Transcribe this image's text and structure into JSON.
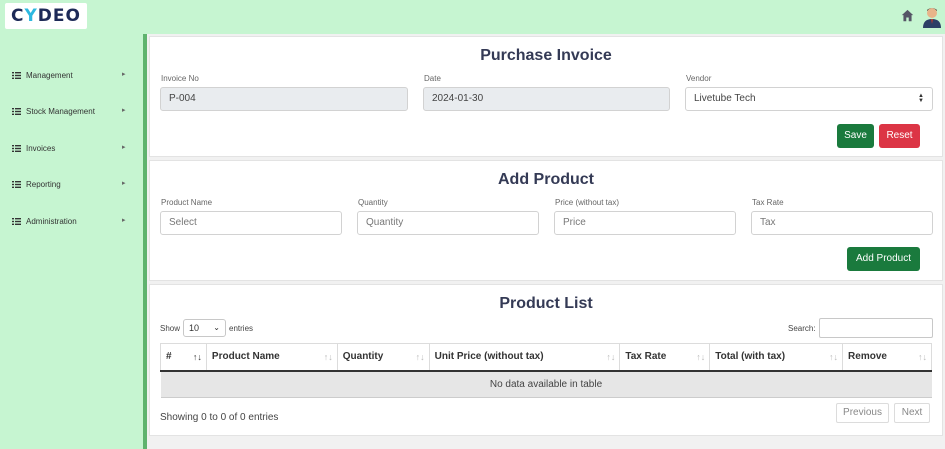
{
  "brand": {
    "logo_pre": "C",
    "logo_accent": "Y",
    "logo_post": "DEO"
  },
  "sidebar": {
    "items": [
      {
        "label": "Management"
      },
      {
        "label": "Stock Management"
      },
      {
        "label": "Invoices"
      },
      {
        "label": "Reporting"
      },
      {
        "label": "Administration"
      }
    ]
  },
  "invoice": {
    "title": "Purchase Invoice",
    "invoice_no_label": "Invoice No",
    "invoice_no_value": "P-004",
    "date_label": "Date",
    "date_value": "2024-01-30",
    "vendor_label": "Vendor",
    "vendor_value": "Livetube Tech",
    "save_label": "Save",
    "reset_label": "Reset"
  },
  "add_product": {
    "title": "Add Product",
    "name_label": "Product Name",
    "name_placeholder": "Select",
    "qty_label": "Quantity",
    "qty_placeholder": "Quantity",
    "price_label": "Price (without tax)",
    "price_placeholder": "Price",
    "tax_label": "Tax Rate",
    "tax_placeholder": "Tax",
    "button_label": "Add Product"
  },
  "product_list": {
    "title": "Product List",
    "show_label": "Show",
    "entries_value": "10",
    "entries_label": "entries",
    "search_label": "Search:",
    "columns": [
      "#",
      "Product Name",
      "Quantity",
      "Unit Price (without tax)",
      "Tax Rate",
      "Total (with tax)",
      "Remove"
    ],
    "empty_text": "No data available in table",
    "info_text": "Showing 0 to 0 of 0 entries",
    "previous_label": "Previous",
    "next_label": "Next"
  },
  "colors": {
    "topbar": "#c6f5d1",
    "sidebar_border": "#5fb36e",
    "primary_green": "#1a7a3d",
    "danger_red": "#dc3545"
  }
}
